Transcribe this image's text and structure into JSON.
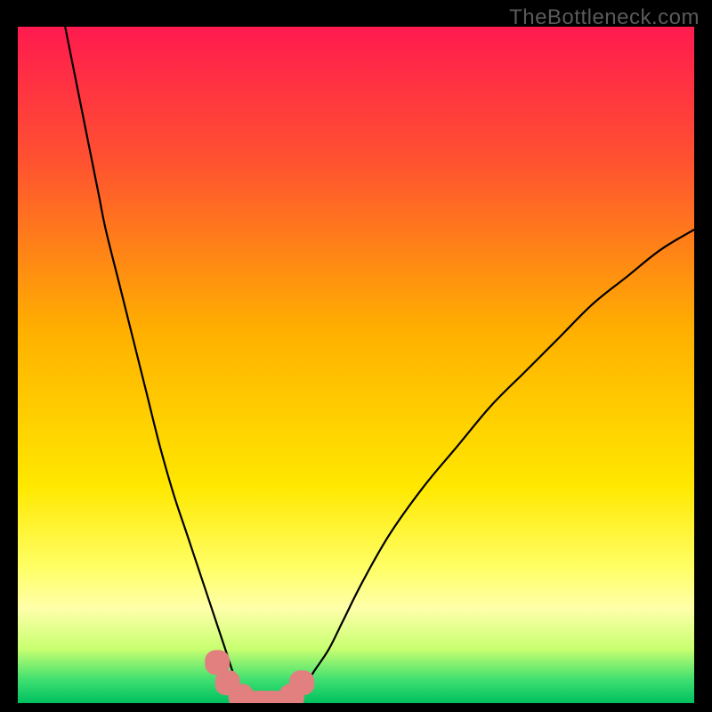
{
  "watermark": "TheBottleneck.com",
  "chart_data": {
    "type": "line",
    "title": "",
    "xlabel": "",
    "ylabel": "",
    "xlim": [
      0,
      100
    ],
    "ylim": [
      0,
      100
    ],
    "grid": false,
    "background_gradient_stops": [
      {
        "offset": 0.0,
        "color": "#ff1a4f"
      },
      {
        "offset": 0.2,
        "color": "#ff5230"
      },
      {
        "offset": 0.45,
        "color": "#ffb000"
      },
      {
        "offset": 0.68,
        "color": "#ffe800"
      },
      {
        "offset": 0.8,
        "color": "#ffff66"
      },
      {
        "offset": 0.86,
        "color": "#ffffaa"
      },
      {
        "offset": 0.92,
        "color": "#c8ff70"
      },
      {
        "offset": 0.965,
        "color": "#40e070"
      },
      {
        "offset": 1.0,
        "color": "#00c060"
      }
    ],
    "series": [
      {
        "name": "left-curve",
        "color": "#000000",
        "width": 2.2,
        "x": [
          7,
          8,
          9,
          10,
          11,
          12,
          13,
          15,
          17,
          19,
          21,
          23,
          25,
          27,
          29,
          30,
          31,
          32,
          33,
          33.5,
          34,
          36,
          38
        ],
        "y": [
          100,
          95,
          90,
          85,
          80,
          75,
          70,
          62,
          54,
          46,
          38,
          31,
          25,
          19,
          13,
          10,
          7,
          4,
          2,
          1,
          0,
          0,
          0
        ]
      },
      {
        "name": "right-curve",
        "color": "#000000",
        "width": 2.2,
        "x": [
          38,
          40,
          41,
          42,
          44,
          46,
          48,
          51,
          55,
          60,
          65,
          70,
          75,
          80,
          85,
          90,
          95,
          100
        ],
        "y": [
          0,
          0,
          1,
          2,
          5,
          8,
          12,
          18,
          25,
          32,
          38,
          44,
          49,
          54,
          59,
          63,
          67,
          70
        ]
      },
      {
        "name": "valley-dots",
        "color": "#e28080",
        "type": "marker-band",
        "x": [
          29.5,
          31,
          33,
          34.5,
          36,
          37.5,
          39,
          40.5,
          42
        ],
        "y": [
          6,
          3,
          1,
          0,
          0,
          0,
          0,
          1,
          3
        ]
      }
    ]
  }
}
